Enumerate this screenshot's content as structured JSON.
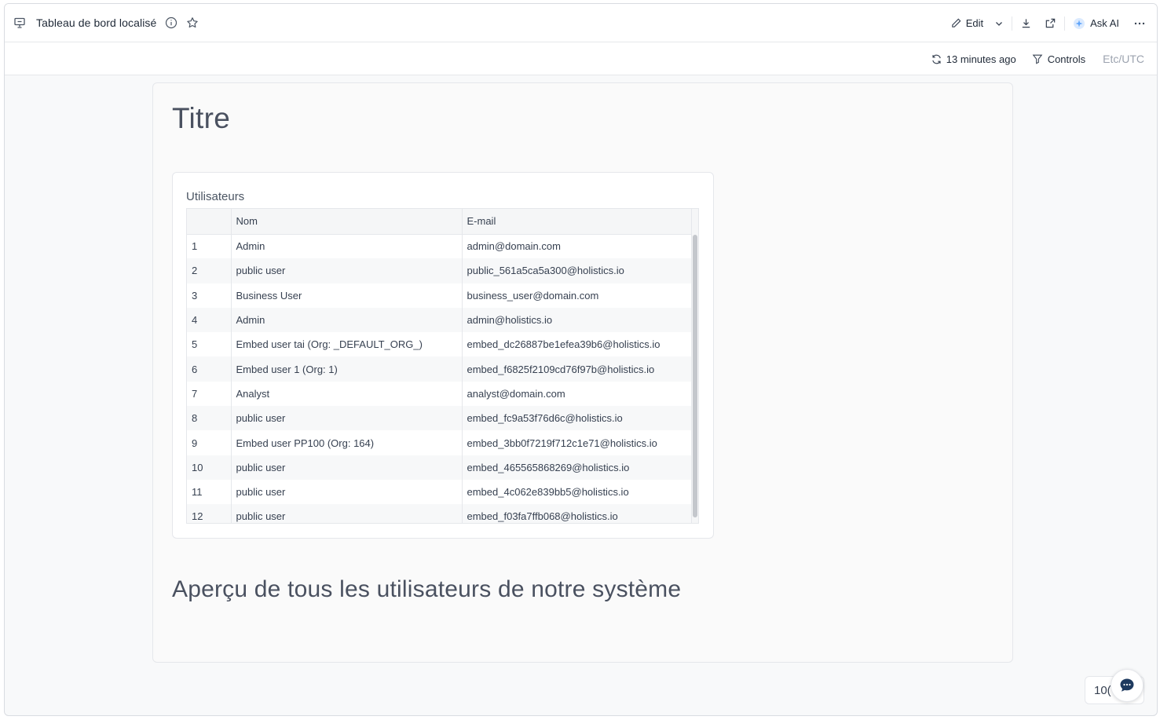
{
  "header": {
    "title": "Tableau de bord localisé",
    "edit_label": "Edit",
    "ask_ai_label": "Ask AI"
  },
  "subbar": {
    "refresh_label": "13 minutes ago",
    "controls_label": "Controls",
    "timezone": "Etc/UTC"
  },
  "canvas": {
    "title": "Titre",
    "description": "Aperçu de tous les utilisateurs de notre système"
  },
  "widget": {
    "title": "Utilisateurs",
    "columns": [
      "",
      "Nom",
      "E-mail"
    ],
    "rows": [
      [
        "1",
        "Admin",
        "admin@domain.com"
      ],
      [
        "2",
        "public user",
        "public_561a5ca5a300@holistics.io"
      ],
      [
        "3",
        "Business User",
        "business_user@domain.com"
      ],
      [
        "4",
        "Admin",
        "admin@holistics.io"
      ],
      [
        "5",
        "Embed user tai (Org: _DEFAULT_ORG_)",
        "embed_dc26887be1efea39b6@holistics.io"
      ],
      [
        "6",
        "Embed user 1 (Org: 1)",
        "embed_f6825f2109cd76f97b@holistics.io"
      ],
      [
        "7",
        "Analyst",
        "analyst@domain.com"
      ],
      [
        "8",
        "public user",
        "embed_fc9a53f76d6c@holistics.io"
      ],
      [
        "9",
        "Embed user PP100 (Org: 164)",
        "embed_3bb0f7219f712c1e71@holistics.io"
      ],
      [
        "10",
        "public user",
        "embed_465565868269@holistics.io"
      ],
      [
        "11",
        "public user",
        "embed_4c062e839bb5@holistics.io"
      ],
      [
        "12",
        "public user",
        "embed_f03fa7ffb068@holistics.io"
      ]
    ]
  },
  "footer": {
    "zoom_label": "10("
  }
}
